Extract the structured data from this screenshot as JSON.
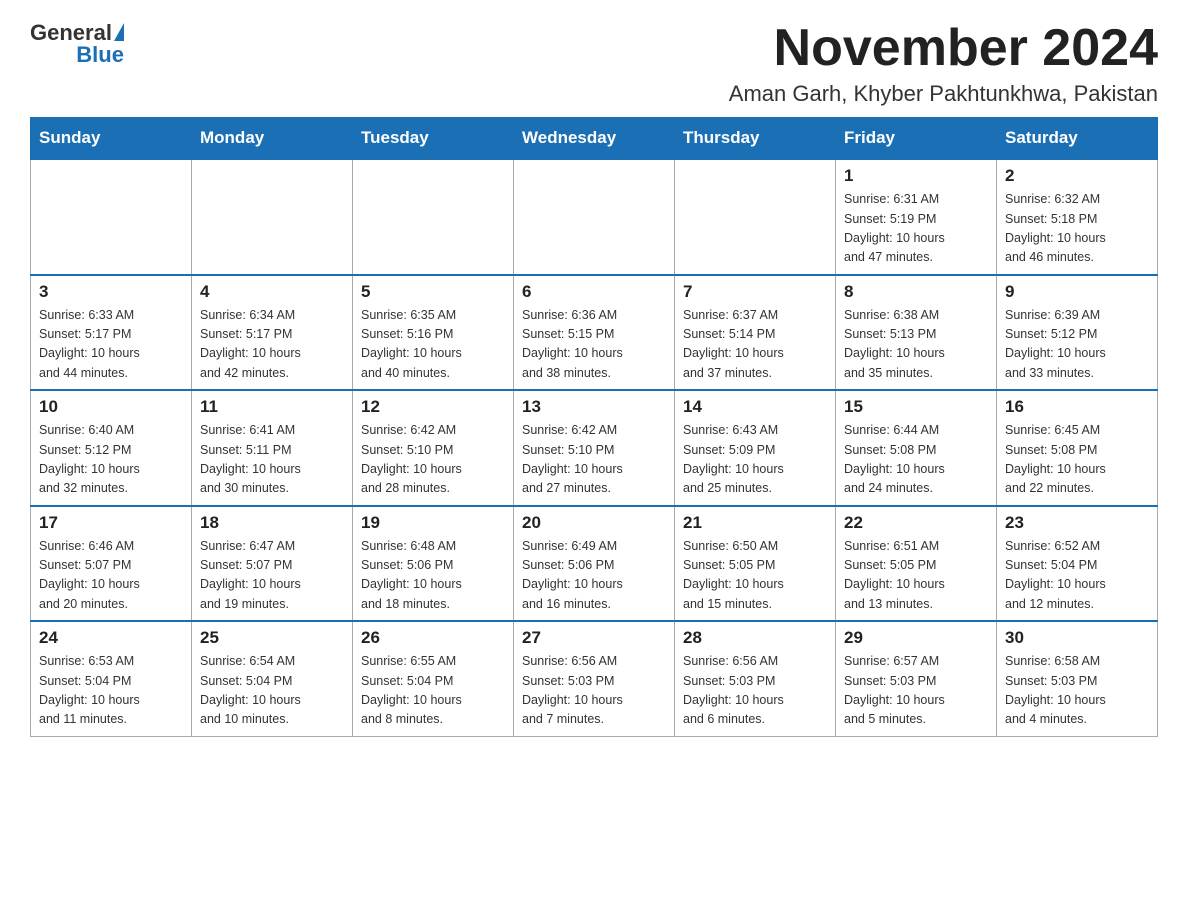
{
  "logo": {
    "text_general": "General",
    "text_blue": "Blue"
  },
  "title": "November 2024",
  "location": "Aman Garh, Khyber Pakhtunkhwa, Pakistan",
  "weekdays": [
    "Sunday",
    "Monday",
    "Tuesday",
    "Wednesday",
    "Thursday",
    "Friday",
    "Saturday"
  ],
  "weeks": [
    [
      {
        "day": "",
        "info": ""
      },
      {
        "day": "",
        "info": ""
      },
      {
        "day": "",
        "info": ""
      },
      {
        "day": "",
        "info": ""
      },
      {
        "day": "",
        "info": ""
      },
      {
        "day": "1",
        "info": "Sunrise: 6:31 AM\nSunset: 5:19 PM\nDaylight: 10 hours\nand 47 minutes."
      },
      {
        "day": "2",
        "info": "Sunrise: 6:32 AM\nSunset: 5:18 PM\nDaylight: 10 hours\nand 46 minutes."
      }
    ],
    [
      {
        "day": "3",
        "info": "Sunrise: 6:33 AM\nSunset: 5:17 PM\nDaylight: 10 hours\nand 44 minutes."
      },
      {
        "day": "4",
        "info": "Sunrise: 6:34 AM\nSunset: 5:17 PM\nDaylight: 10 hours\nand 42 minutes."
      },
      {
        "day": "5",
        "info": "Sunrise: 6:35 AM\nSunset: 5:16 PM\nDaylight: 10 hours\nand 40 minutes."
      },
      {
        "day": "6",
        "info": "Sunrise: 6:36 AM\nSunset: 5:15 PM\nDaylight: 10 hours\nand 38 minutes."
      },
      {
        "day": "7",
        "info": "Sunrise: 6:37 AM\nSunset: 5:14 PM\nDaylight: 10 hours\nand 37 minutes."
      },
      {
        "day": "8",
        "info": "Sunrise: 6:38 AM\nSunset: 5:13 PM\nDaylight: 10 hours\nand 35 minutes."
      },
      {
        "day": "9",
        "info": "Sunrise: 6:39 AM\nSunset: 5:12 PM\nDaylight: 10 hours\nand 33 minutes."
      }
    ],
    [
      {
        "day": "10",
        "info": "Sunrise: 6:40 AM\nSunset: 5:12 PM\nDaylight: 10 hours\nand 32 minutes."
      },
      {
        "day": "11",
        "info": "Sunrise: 6:41 AM\nSunset: 5:11 PM\nDaylight: 10 hours\nand 30 minutes."
      },
      {
        "day": "12",
        "info": "Sunrise: 6:42 AM\nSunset: 5:10 PM\nDaylight: 10 hours\nand 28 minutes."
      },
      {
        "day": "13",
        "info": "Sunrise: 6:42 AM\nSunset: 5:10 PM\nDaylight: 10 hours\nand 27 minutes."
      },
      {
        "day": "14",
        "info": "Sunrise: 6:43 AM\nSunset: 5:09 PM\nDaylight: 10 hours\nand 25 minutes."
      },
      {
        "day": "15",
        "info": "Sunrise: 6:44 AM\nSunset: 5:08 PM\nDaylight: 10 hours\nand 24 minutes."
      },
      {
        "day": "16",
        "info": "Sunrise: 6:45 AM\nSunset: 5:08 PM\nDaylight: 10 hours\nand 22 minutes."
      }
    ],
    [
      {
        "day": "17",
        "info": "Sunrise: 6:46 AM\nSunset: 5:07 PM\nDaylight: 10 hours\nand 20 minutes."
      },
      {
        "day": "18",
        "info": "Sunrise: 6:47 AM\nSunset: 5:07 PM\nDaylight: 10 hours\nand 19 minutes."
      },
      {
        "day": "19",
        "info": "Sunrise: 6:48 AM\nSunset: 5:06 PM\nDaylight: 10 hours\nand 18 minutes."
      },
      {
        "day": "20",
        "info": "Sunrise: 6:49 AM\nSunset: 5:06 PM\nDaylight: 10 hours\nand 16 minutes."
      },
      {
        "day": "21",
        "info": "Sunrise: 6:50 AM\nSunset: 5:05 PM\nDaylight: 10 hours\nand 15 minutes."
      },
      {
        "day": "22",
        "info": "Sunrise: 6:51 AM\nSunset: 5:05 PM\nDaylight: 10 hours\nand 13 minutes."
      },
      {
        "day": "23",
        "info": "Sunrise: 6:52 AM\nSunset: 5:04 PM\nDaylight: 10 hours\nand 12 minutes."
      }
    ],
    [
      {
        "day": "24",
        "info": "Sunrise: 6:53 AM\nSunset: 5:04 PM\nDaylight: 10 hours\nand 11 minutes."
      },
      {
        "day": "25",
        "info": "Sunrise: 6:54 AM\nSunset: 5:04 PM\nDaylight: 10 hours\nand 10 minutes."
      },
      {
        "day": "26",
        "info": "Sunrise: 6:55 AM\nSunset: 5:04 PM\nDaylight: 10 hours\nand 8 minutes."
      },
      {
        "day": "27",
        "info": "Sunrise: 6:56 AM\nSunset: 5:03 PM\nDaylight: 10 hours\nand 7 minutes."
      },
      {
        "day": "28",
        "info": "Sunrise: 6:56 AM\nSunset: 5:03 PM\nDaylight: 10 hours\nand 6 minutes."
      },
      {
        "day": "29",
        "info": "Sunrise: 6:57 AM\nSunset: 5:03 PM\nDaylight: 10 hours\nand 5 minutes."
      },
      {
        "day": "30",
        "info": "Sunrise: 6:58 AM\nSunset: 5:03 PM\nDaylight: 10 hours\nand 4 minutes."
      }
    ]
  ]
}
